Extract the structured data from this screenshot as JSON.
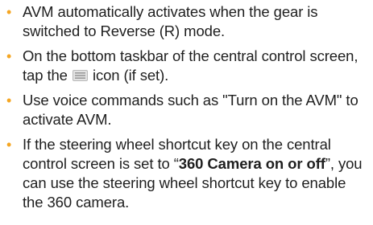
{
  "colors": {
    "bullet": "#f5a623",
    "text": "#1f1f1f",
    "icon": "#b9b9b9"
  },
  "items": [
    {
      "text": "AVM automatically activates when the gear is switched to Reverse (R) mode."
    },
    {
      "before": "On the bottom taskbar of the central control screen, tap the ",
      "icon": "taskbar-icon",
      "after": " icon (if set)."
    },
    {
      "text": "Use voice commands such as \"Turn on the AVM\" to activate AVM."
    },
    {
      "before": "If the steering wheel shortcut key on the central control screen is set to “",
      "bold": "360 Camera on or off",
      "after": "”, you can use the steering wheel shortcut key to enable the 360 camera."
    }
  ]
}
